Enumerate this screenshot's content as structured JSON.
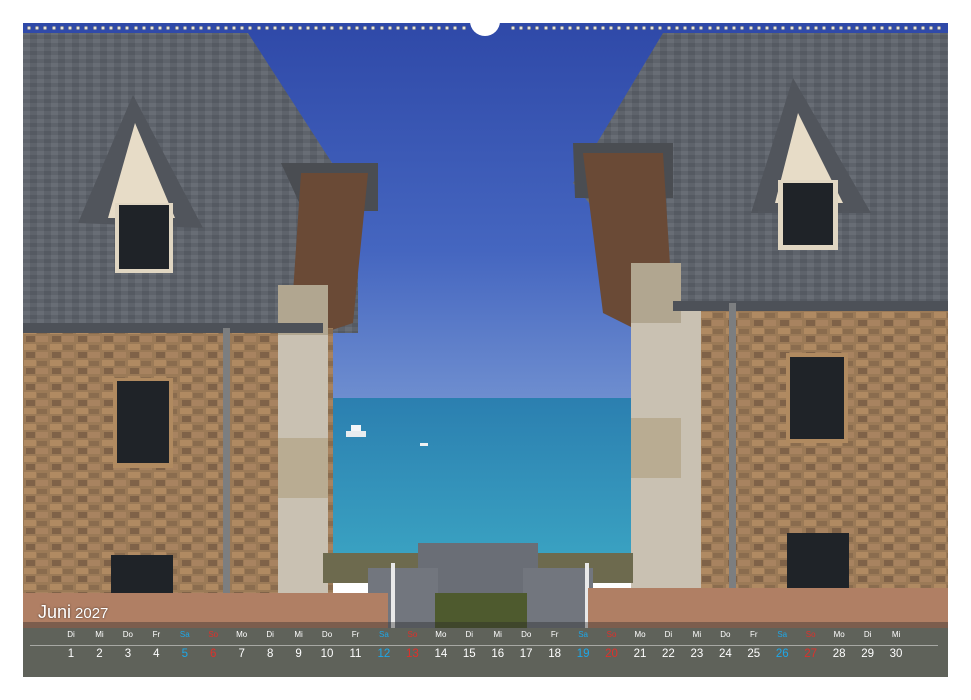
{
  "calendar": {
    "month": "Juni",
    "year": "2027",
    "days": [
      {
        "name": "Di",
        "num": "1",
        "type": "weekday"
      },
      {
        "name": "Mi",
        "num": "2",
        "type": "weekday"
      },
      {
        "name": "Do",
        "num": "3",
        "type": "weekday"
      },
      {
        "name": "Fr",
        "num": "4",
        "type": "weekday"
      },
      {
        "name": "Sa",
        "num": "5",
        "type": "saturday"
      },
      {
        "name": "So",
        "num": "6",
        "type": "sunday"
      },
      {
        "name": "Mo",
        "num": "7",
        "type": "weekday"
      },
      {
        "name": "Di",
        "num": "8",
        "type": "weekday"
      },
      {
        "name": "Mi",
        "num": "9",
        "type": "weekday"
      },
      {
        "name": "Do",
        "num": "10",
        "type": "weekday"
      },
      {
        "name": "Fr",
        "num": "11",
        "type": "weekday"
      },
      {
        "name": "Sa",
        "num": "12",
        "type": "saturday"
      },
      {
        "name": "So",
        "num": "13",
        "type": "sunday"
      },
      {
        "name": "Mo",
        "num": "14",
        "type": "weekday"
      },
      {
        "name": "Di",
        "num": "15",
        "type": "weekday"
      },
      {
        "name": "Mi",
        "num": "16",
        "type": "weekday"
      },
      {
        "name": "Do",
        "num": "17",
        "type": "weekday"
      },
      {
        "name": "Fr",
        "num": "18",
        "type": "weekday"
      },
      {
        "name": "Sa",
        "num": "19",
        "type": "saturday"
      },
      {
        "name": "So",
        "num": "20",
        "type": "sunday"
      },
      {
        "name": "Mo",
        "num": "21",
        "type": "weekday"
      },
      {
        "name": "Di",
        "num": "22",
        "type": "weekday"
      },
      {
        "name": "Mi",
        "num": "23",
        "type": "weekday"
      },
      {
        "name": "Do",
        "num": "24",
        "type": "weekday"
      },
      {
        "name": "Fr",
        "num": "25",
        "type": "weekday"
      },
      {
        "name": "Sa",
        "num": "26",
        "type": "saturday"
      },
      {
        "name": "So",
        "num": "27",
        "type": "sunday"
      },
      {
        "name": "Mo",
        "num": "28",
        "type": "weekday"
      },
      {
        "name": "Di",
        "num": "29",
        "type": "weekday"
      },
      {
        "name": "Mi",
        "num": "30",
        "type": "weekday"
      }
    ]
  },
  "colors": {
    "saturday": "#1da7e8",
    "sunday": "#e0302a",
    "sky": "#3a56b4",
    "sea": "#2a8fb4",
    "roof": "#5c6068",
    "stone": "#9a7a58"
  }
}
